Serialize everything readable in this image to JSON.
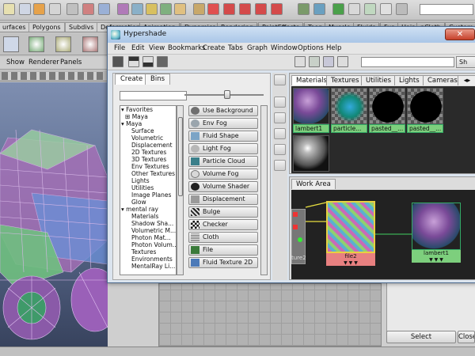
{
  "maya": {
    "shelf_tabs": [
      "urfaces",
      "Polygons",
      "Subdivs",
      "Deformation",
      "Animation",
      "Dynamics",
      "Rendering",
      "PaintEffects",
      "Toon",
      "Muscle",
      "Fluids",
      "Fur",
      "Hair",
      "nCloth",
      "Custom"
    ],
    "viewport_menu": [
      "Show",
      "Renderer",
      "Panels"
    ],
    "select_labels": [
      "Select",
      "Close"
    ]
  },
  "hypershade": {
    "title": "Hypershade",
    "close_glyph": "✕",
    "menu": [
      "File",
      "Edit",
      "View",
      "Bookmarks",
      "Create",
      "Tabs",
      "Graph",
      "Window",
      "Options",
      "Help"
    ],
    "show_label": "Sh",
    "create_tabs": [
      "Create",
      "Bins"
    ],
    "tree": [
      {
        "label": "Favorites",
        "prefix": "▾"
      },
      {
        "label": "Maya",
        "prefix": "⊞"
      },
      {
        "label": "Maya",
        "prefix": "▾"
      },
      {
        "label": "Surface",
        "prefix": ""
      },
      {
        "label": "Volumetric",
        "prefix": ""
      },
      {
        "label": "Displacement",
        "prefix": ""
      },
      {
        "label": "2D Textures",
        "prefix": ""
      },
      {
        "label": "3D Textures",
        "prefix": ""
      },
      {
        "label": "Env Textures",
        "prefix": ""
      },
      {
        "label": "Other Textures",
        "prefix": ""
      },
      {
        "label": "Lights",
        "prefix": ""
      },
      {
        "label": "Utilities",
        "prefix": ""
      },
      {
        "label": "Image Planes",
        "prefix": ""
      },
      {
        "label": "Glow",
        "prefix": ""
      },
      {
        "label": "mental ray",
        "prefix": "▾"
      },
      {
        "label": "Materials",
        "prefix": ""
      },
      {
        "label": "Shadow Sha...",
        "prefix": ""
      },
      {
        "label": "Volumetric M...",
        "prefix": ""
      },
      {
        "label": "Photon Mat...",
        "prefix": ""
      },
      {
        "label": "Photon Volum...",
        "prefix": ""
      },
      {
        "label": "Textures",
        "prefix": ""
      },
      {
        "label": "Environments",
        "prefix": ""
      },
      {
        "label": "MentalRay Li...",
        "prefix": ""
      }
    ],
    "nodes": [
      {
        "label": "Use Background",
        "color": "#6f6f6f"
      },
      {
        "label": "Env Fog",
        "color": "#9aa5ad"
      },
      {
        "label": "Fluid Shape",
        "color": "#7ba4c6"
      },
      {
        "label": "Light Fog",
        "color": "#b7b7b7"
      },
      {
        "label": "Particle Cloud",
        "color": "#3a7f8a"
      },
      {
        "label": "Volume Fog",
        "color": "#d8d8d8"
      },
      {
        "label": "Volume Shader",
        "color": "#222222"
      },
      {
        "label": "Displacement",
        "color": "#9a9a9a"
      },
      {
        "label": "Bulge",
        "color": "#555555"
      },
      {
        "label": "Checker",
        "color": "#333333"
      },
      {
        "label": "Cloth",
        "color": "#8a8a8a"
      },
      {
        "label": "File",
        "color": "#3a7a3a"
      },
      {
        "label": "Fluid Texture 2D",
        "color": "#4c7ab8"
      }
    ],
    "mat_tabs": [
      "Materials",
      "Textures",
      "Utilities",
      "Lights",
      "Cameras"
    ],
    "swatches": [
      {
        "label": "lambert1"
      },
      {
        "label": "particle..."
      },
      {
        "label": "pasted__..."
      },
      {
        "label": "pasted__..."
      },
      {
        "label": ""
      }
    ],
    "work_tab": "Work Area",
    "graph": {
      "place_label": "ture2",
      "file_label": "file2",
      "lambert_label": "lambert1",
      "arrows": "▼ ▼ ▼"
    }
  }
}
